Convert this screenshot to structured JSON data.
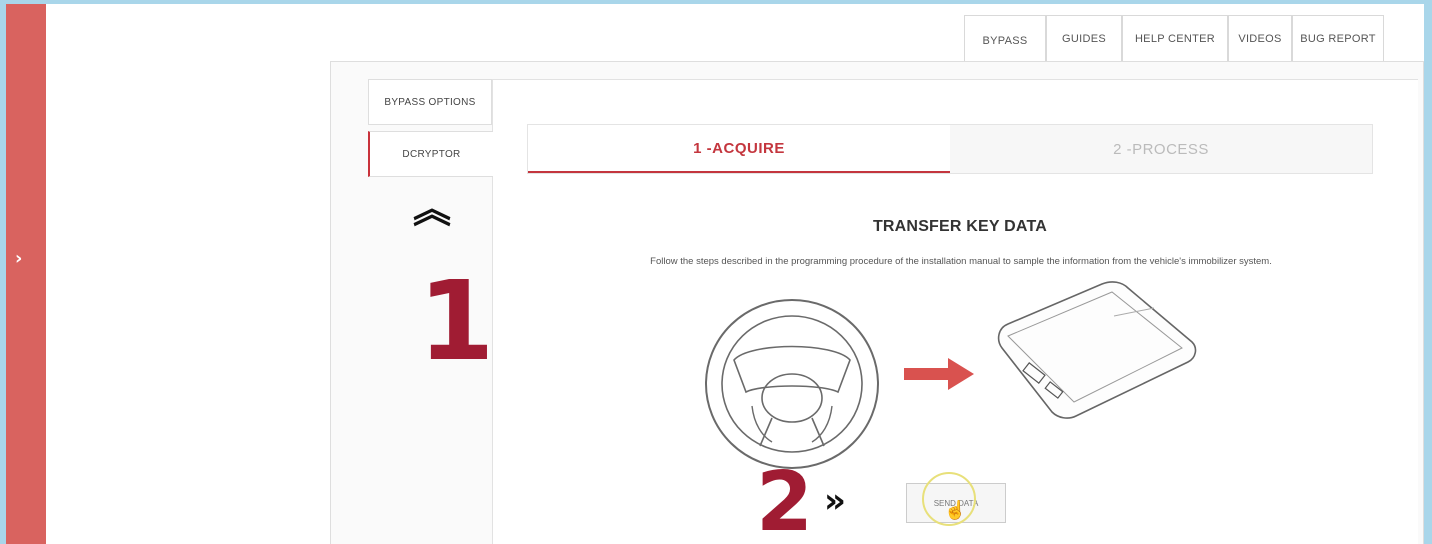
{
  "sidebar": {
    "toggle_icon": "chevron-right-icon",
    "color": "#d9635f"
  },
  "top_tabs": [
    {
      "label": "BYPASS",
      "active": true
    },
    {
      "label": "GUIDES",
      "active": false
    },
    {
      "label": "HELP CENTER",
      "active": false
    },
    {
      "label": "VIDEOS",
      "active": false
    },
    {
      "label": "BUG REPORT",
      "active": false
    }
  ],
  "side_tabs": [
    {
      "label": "BYPASS OPTIONS",
      "active": false
    },
    {
      "label": "DCRYPTOR",
      "active": true
    }
  ],
  "steps": [
    {
      "label": "1 -ACQUIRE",
      "active": true
    },
    {
      "label": "2 -PROCESS",
      "active": false
    }
  ],
  "content": {
    "title": "TRANSFER KEY DATA",
    "description": "Follow the steps described in the programming procedure of the installation manual to sample the information from the vehicle's immobilizer system.",
    "send_button_label": "SEND DATA",
    "accent_color": "#c4363e"
  },
  "annotations": {
    "marker_1": "1",
    "marker_2": "2",
    "marker_color": "#a01c33"
  }
}
